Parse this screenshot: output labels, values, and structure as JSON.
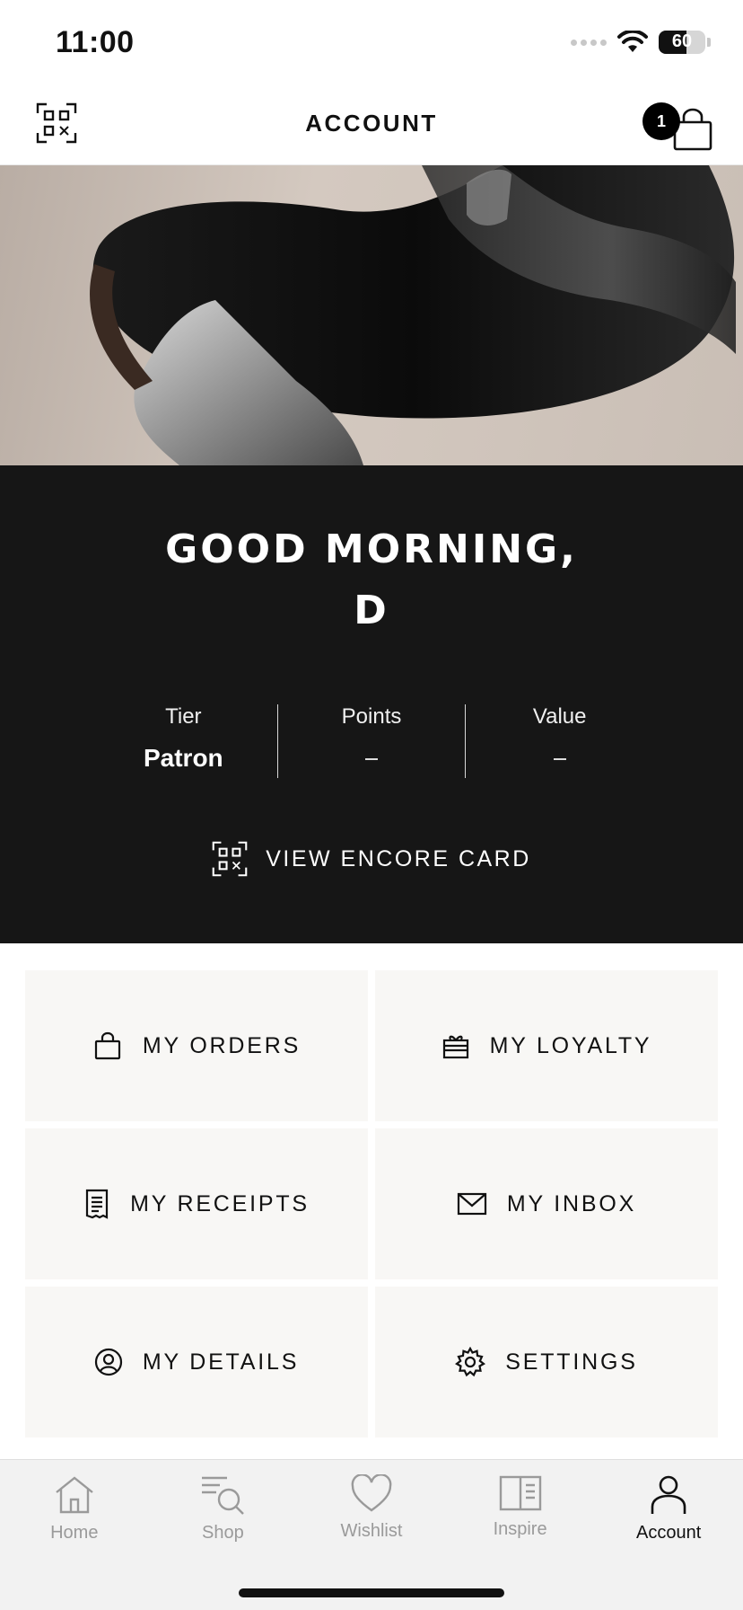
{
  "status_bar": {
    "time": "11:00",
    "battery": "60"
  },
  "header": {
    "title": "ACCOUNT",
    "bag_count": "1"
  },
  "greeting": {
    "line1": "GOOD MORNING,",
    "line2": "D"
  },
  "stats": [
    {
      "label": "Tier",
      "value": "Patron"
    },
    {
      "label": "Points",
      "value": ""
    },
    {
      "label": "Value",
      "value": ""
    }
  ],
  "encore": {
    "label": "VIEW ENCORE CARD"
  },
  "tiles": [
    {
      "label": "MY ORDERS",
      "icon": "bag-icon"
    },
    {
      "label": "MY LOYALTY",
      "icon": "gift-icon"
    },
    {
      "label": "MY RECEIPTS",
      "icon": "receipt-icon"
    },
    {
      "label": "MY INBOX",
      "icon": "envelope-icon"
    },
    {
      "label": "MY DETAILS",
      "icon": "user-circle-icon"
    },
    {
      "label": "SETTINGS",
      "icon": "gear-icon"
    }
  ],
  "nav": [
    {
      "label": "Home",
      "icon": "home-icon"
    },
    {
      "label": "Shop",
      "icon": "search-list-icon"
    },
    {
      "label": "Wishlist",
      "icon": "heart-icon"
    },
    {
      "label": "Inspire",
      "icon": "book-icon"
    },
    {
      "label": "Account",
      "icon": "person-icon",
      "active": true
    }
  ],
  "colors": {
    "panel": "#161616",
    "tile": "#f8f7f5",
    "nav_bg": "#f2f2f2",
    "inactive": "#9a9a9a"
  }
}
